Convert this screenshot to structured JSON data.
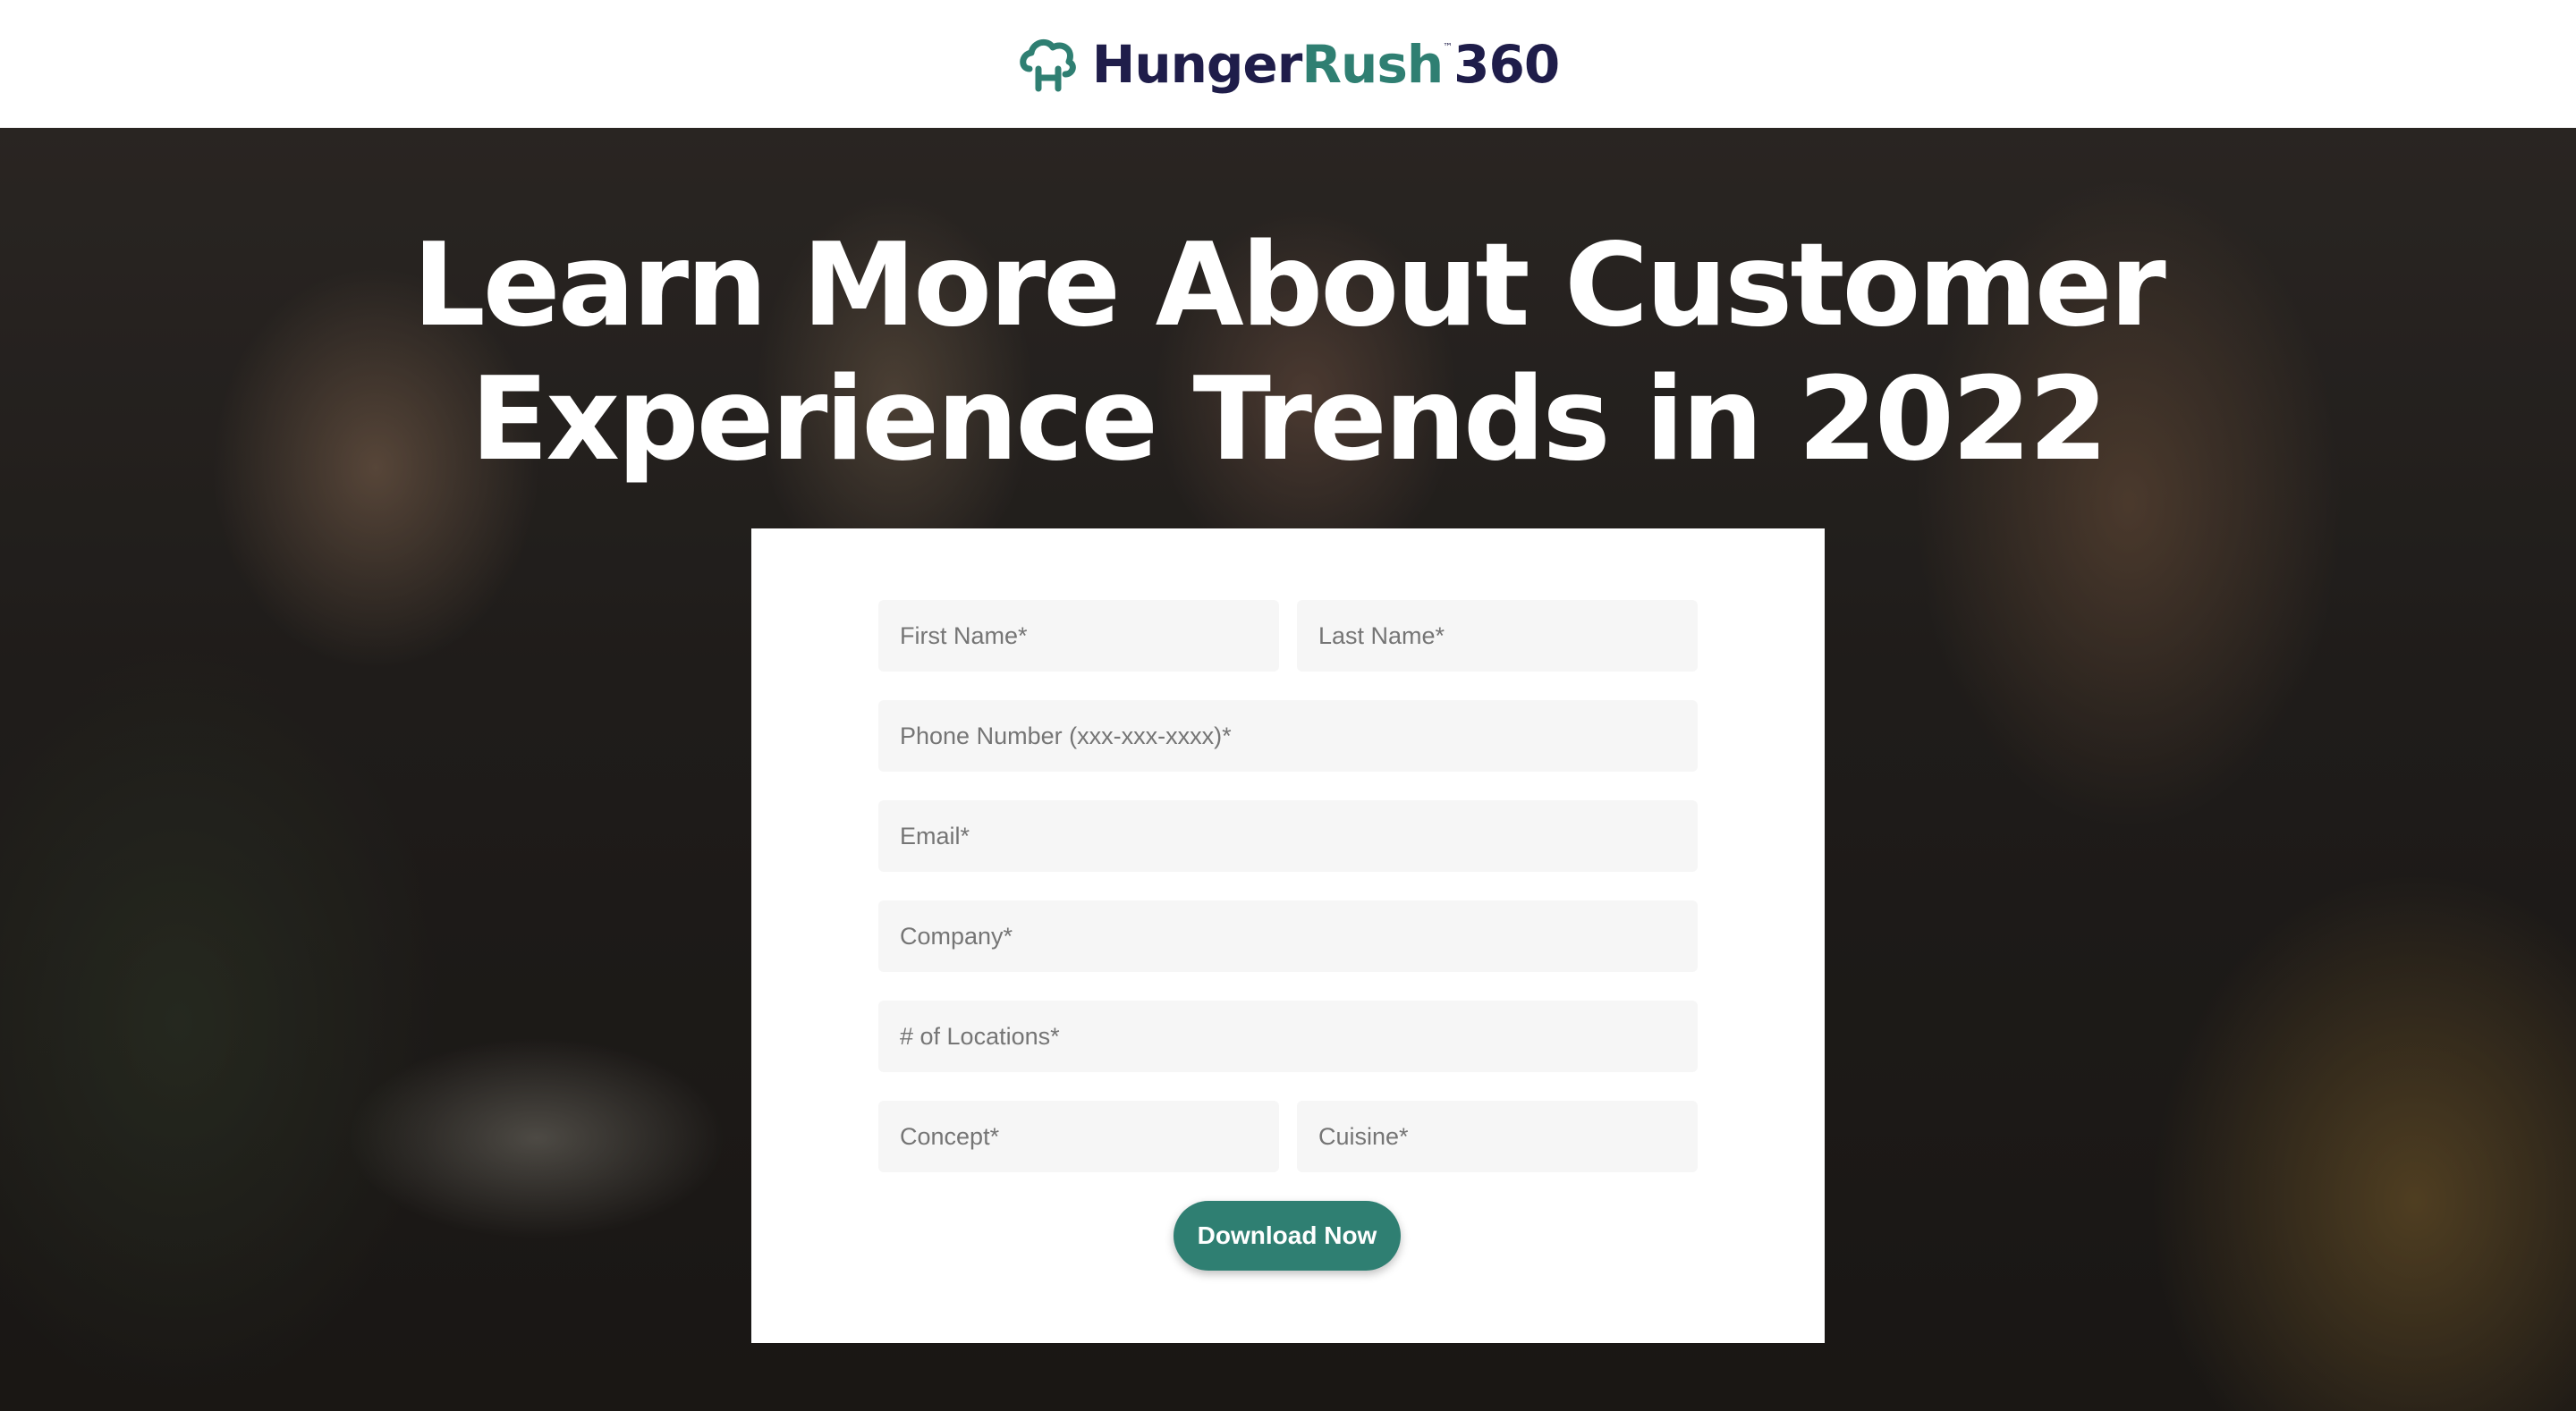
{
  "brand": {
    "logo_word_1": "Hunger",
    "logo_word_2": "Rush",
    "logo_trademark": "™",
    "logo_suffix": "360",
    "color_primary": "#2f7f72",
    "color_dark": "#1f1d4a",
    "logo_icon": "cloud-house-icon"
  },
  "hero": {
    "headline_line_1": "Learn More About Customer",
    "headline_line_2": "Experience Trends in 2022"
  },
  "form": {
    "first_name_placeholder": "First Name*",
    "last_name_placeholder": "Last Name*",
    "phone_placeholder": "Phone Number (xxx-xxx-xxxx)*",
    "email_placeholder": "Email*",
    "company_placeholder": "Company*",
    "locations_placeholder": "# of Locations*",
    "concept_placeholder": "Concept*",
    "cuisine_placeholder": "Cuisine*",
    "submit_label": "Download Now"
  }
}
